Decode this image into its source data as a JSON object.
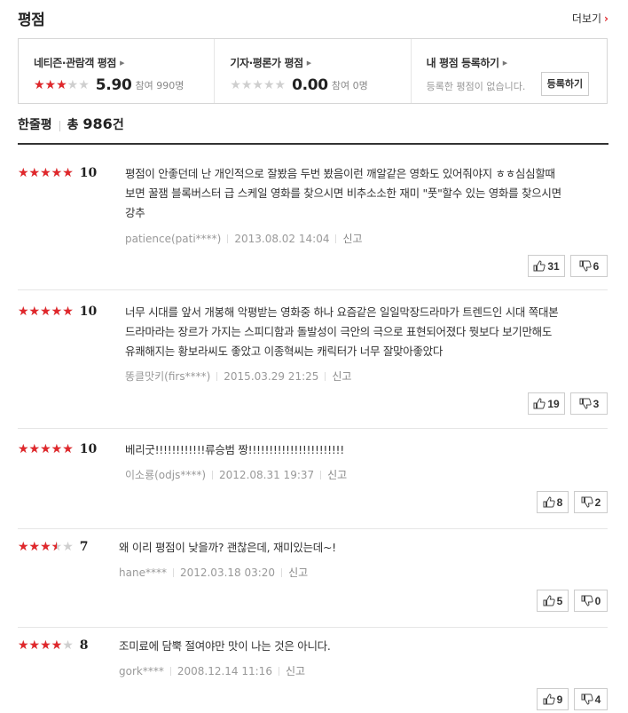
{
  "header": {
    "title": "평점",
    "more_label": "더보기",
    "more_chevron": "›"
  },
  "summary": {
    "netizen": {
      "label": "네티즌·관람객 평점",
      "score": "5.90",
      "participants": "참여 990명",
      "rating_fraction": 0.59
    },
    "critic": {
      "label": "기자·평론가 평점",
      "score": "0.00",
      "participants": "참여 0명",
      "rating_fraction": 0
    },
    "mine": {
      "label": "내 평점 등록하기",
      "empty_text": "등록한 평점이 없습니다.",
      "register_button": "등록하기"
    },
    "arrow": "▶"
  },
  "comments": {
    "label": "한줄평",
    "total_prefix": "총",
    "total_count": "986",
    "total_suffix": "건"
  },
  "reviews": [
    {
      "score": "10",
      "rating_fraction": 1.0,
      "lines": [
        "평점이 안좋던데 난 개인적으로 잘봤음 두번 봤음이런 깨알같은 영화도 있어줘야지 ㅎㅎ심심할때",
        "보면 꿀잼 블록버스터 급 스케일 영화를 찾으시면 비추소소한 재미 \"풋\"할수 있는 영화를 찾으시면",
        "강추"
      ],
      "author": "patience(pati****)",
      "date": "2013.08.02 14:04",
      "report": "신고",
      "likes": "31",
      "dislikes": "6"
    },
    {
      "score": "10",
      "rating_fraction": 1.0,
      "lines": [
        "너무 시대를 앞서 개봉해 악평받는 영화중 하나 요즘같은 일일막장드라마가 트렌드인 시대 쪽대본",
        "드라마라는 장르가 가지는 스피디함과 돌발성이 극안의 극으로 표현되어졌다 뭣보다 보기만해도",
        "유쾌해지는 황보라씨도 좋았고 이종혁씨는 캐릭터가 너무 잘맞아좋았다"
      ],
      "author": "똥클맛키(firs****)",
      "date": "2015.03.29 21:25",
      "report": "신고",
      "likes": "19",
      "dislikes": "3"
    },
    {
      "score": "10",
      "rating_fraction": 1.0,
      "lines": [
        "베리굿!!!!!!!!!!!!류승범 짱!!!!!!!!!!!!!!!!!!!!!!!"
      ],
      "author": "이소룡(odjs****)",
      "date": "2012.08.31 19:37",
      "report": "신고",
      "likes": "8",
      "dislikes": "2"
    },
    {
      "score": "7",
      "rating_fraction": 0.7,
      "lines": [
        "왜 이리 평점이 낮을까? 괜찮은데, 재미있는데~!"
      ],
      "author": "hane****",
      "date": "2012.03.18 03:20",
      "report": "신고",
      "likes": "5",
      "dislikes": "0"
    },
    {
      "score": "8",
      "rating_fraction": 0.8,
      "lines": [
        "조미료에 담뿍 절여야만 맛이 나는 것은 아니다."
      ],
      "author": "gork****",
      "date": "2008.12.14 11:16",
      "report": "신고",
      "likes": "9",
      "dislikes": "4"
    }
  ],
  "icons": {
    "star": "star-icon",
    "thumbs_up": "thumbs-up-icon",
    "thumbs_down": "thumbs-down-icon"
  },
  "colors": {
    "accent": "#e0272b",
    "star_empty": "#cfcfcf"
  }
}
